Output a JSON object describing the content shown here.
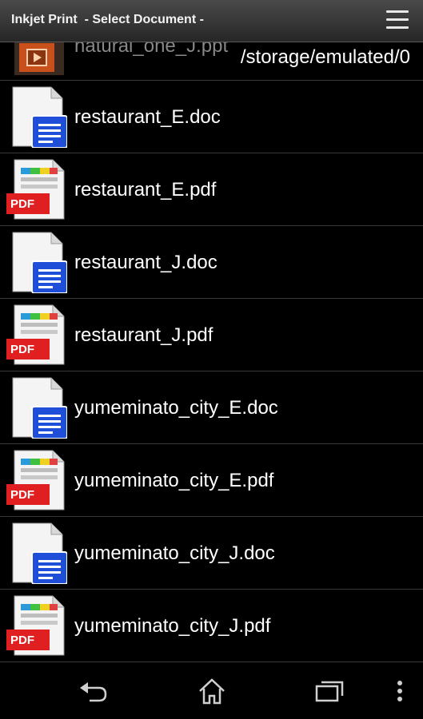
{
  "titlebar": {
    "title": "Inkjet Print  - Select Document -",
    "menu_icon": "hamburger-menu-icon"
  },
  "path": "/storage/emulated/0",
  "files": [
    {
      "name": "natural_one_J.ppt",
      "type": "ppt"
    },
    {
      "name": "restaurant_E.doc",
      "type": "doc"
    },
    {
      "name": "restaurant_E.pdf",
      "type": "pdf"
    },
    {
      "name": "restaurant_J.doc",
      "type": "doc"
    },
    {
      "name": "restaurant_J.pdf",
      "type": "pdf"
    },
    {
      "name": "yumeminato_city_E.doc",
      "type": "doc"
    },
    {
      "name": "yumeminato_city_E.pdf",
      "type": "pdf"
    },
    {
      "name": "yumeminato_city_J.doc",
      "type": "doc"
    },
    {
      "name": "yumeminato_city_J.pdf",
      "type": "pdf"
    }
  ],
  "pdf_badge": "PDF",
  "navbar": {
    "back_icon": "back-icon",
    "home_icon": "home-icon",
    "recents_icon": "recent-apps-icon",
    "overflow_icon": "overflow-menu-icon"
  },
  "colors": {
    "pdf_red": "#e02020",
    "doc_blue": "#1f4fd8",
    "ppt_orange": "#c8501a"
  }
}
